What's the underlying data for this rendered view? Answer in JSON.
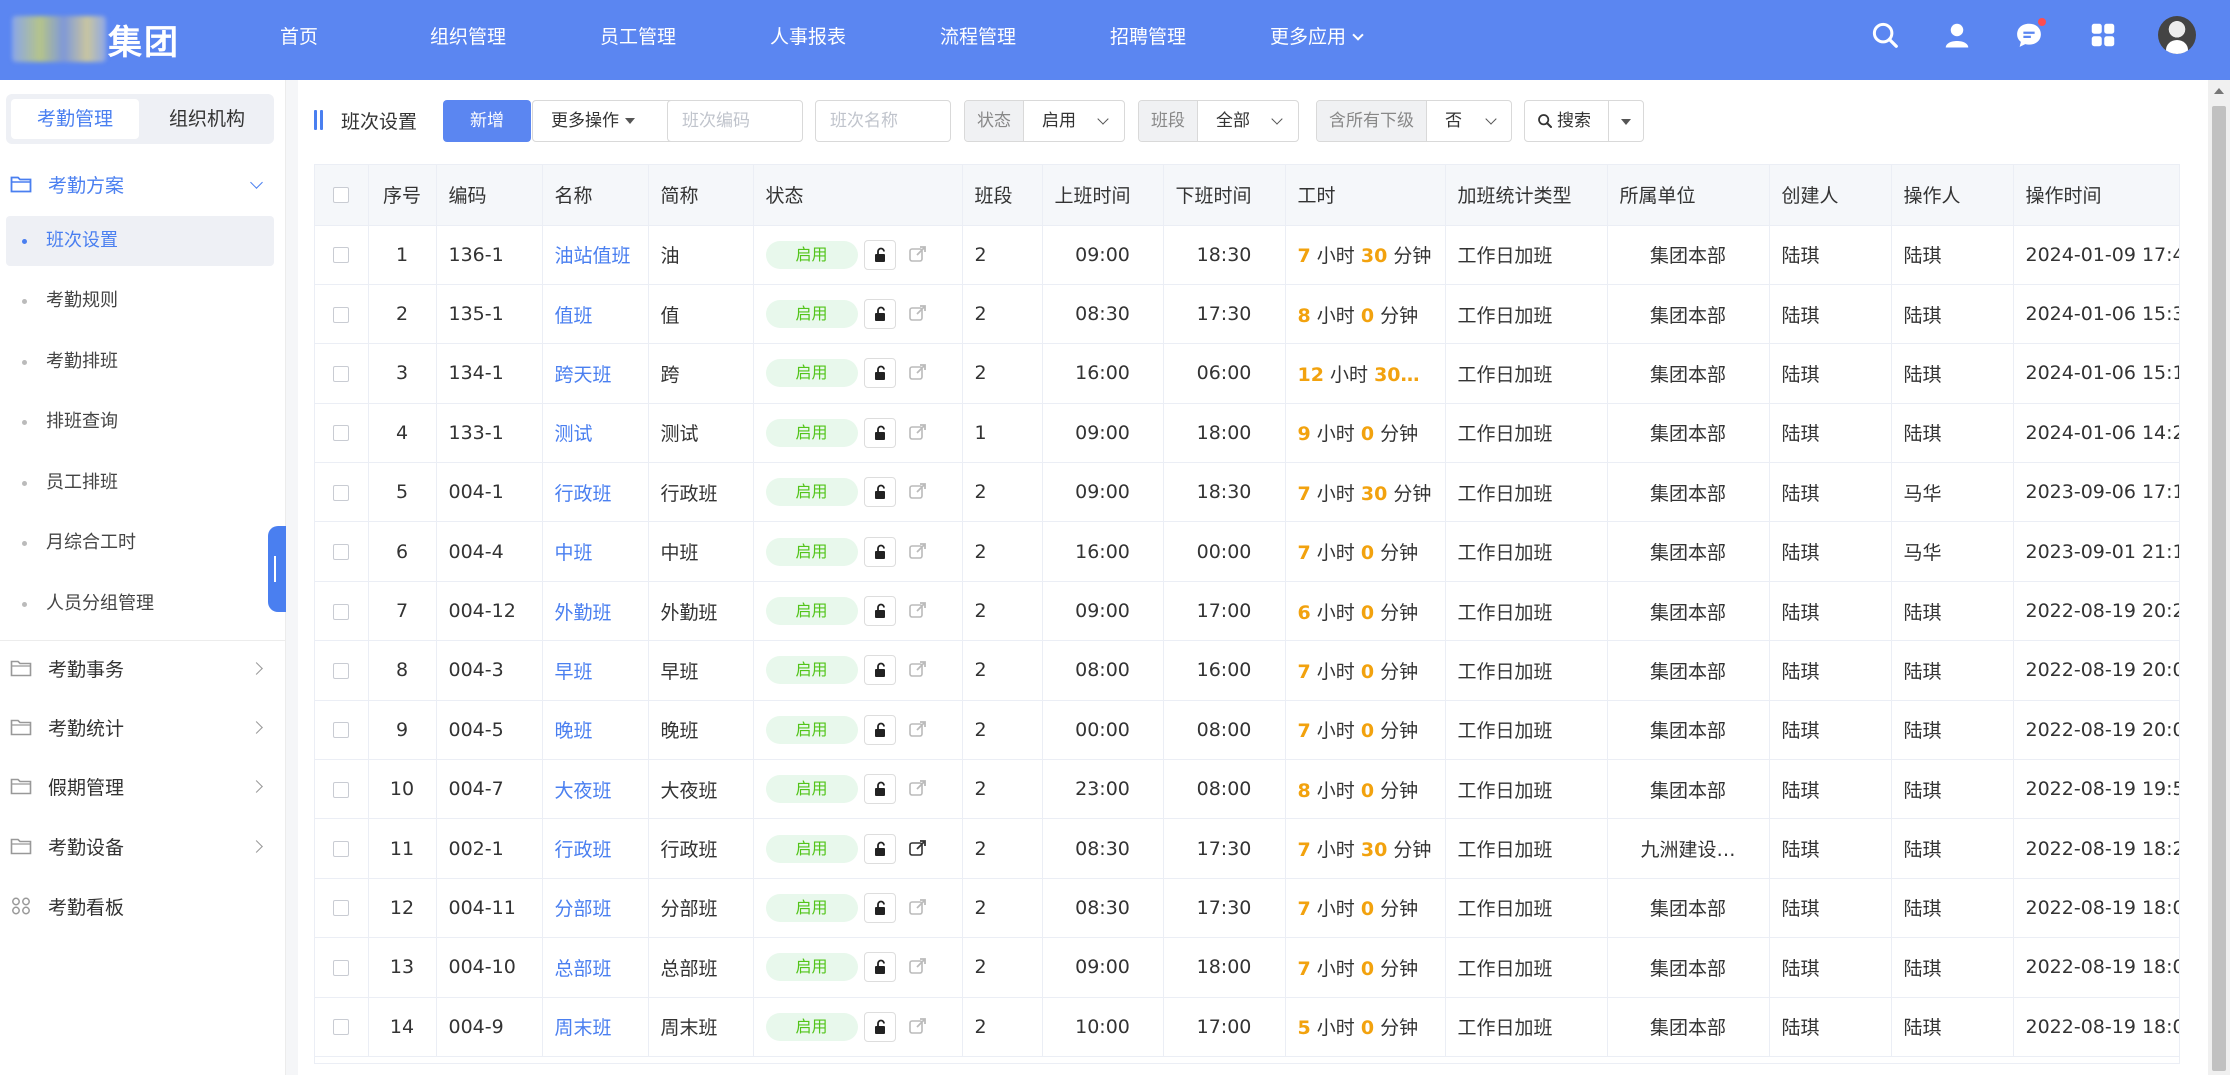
{
  "header": {
    "logo_text": "集团",
    "nav": [
      "首页",
      "组织管理",
      "员工管理",
      "人事报表",
      "流程管理",
      "招聘管理",
      "更多应用"
    ],
    "icons": [
      "search-icon",
      "user-icon",
      "chat-icon",
      "apps-grid-icon",
      "avatar"
    ],
    "accent_color": "#5b86f1"
  },
  "sidebar": {
    "tabs": [
      "考勤管理",
      "组织机构"
    ],
    "groups": [
      {
        "label": "考勤方案",
        "open": true
      },
      {
        "label": "考勤事务"
      },
      {
        "label": "考勤统计"
      },
      {
        "label": "假期管理"
      },
      {
        "label": "考勤设备"
      },
      {
        "label": "考勤看板"
      }
    ],
    "items": [
      "班次设置",
      "考勤规则",
      "考勤排班",
      "排班查询",
      "员工排班",
      "月综合工时",
      "人员分组管理"
    ]
  },
  "toolbar": {
    "title": "班次设置",
    "add_label": "新增",
    "more_label": "更多操作",
    "code_placeholder": "班次编码",
    "name_placeholder": "班次名称",
    "status_label": "状态",
    "status_value": "启用",
    "segment_label": "班段",
    "segment_value": "全部",
    "sub_label": "含所有下级",
    "sub_value": "否",
    "search_label": "搜索"
  },
  "table": {
    "columns": [
      "序号",
      "编码",
      "名称",
      "简称",
      "状态",
      "班段",
      "上班时间",
      "下班时间",
      "工时",
      "加班统计类型",
      "所属单位",
      "创建人",
      "操作人",
      "操作时间"
    ],
    "hour_unit": "小时",
    "minute_unit": "分钟",
    "rows": [
      {
        "idx": "1",
        "code": "136-1",
        "name": "油站值班",
        "short": "油",
        "status": "启用",
        "seg": "2",
        "on": "09:00",
        "off": "18:30",
        "h": "7",
        "m": "30",
        "ot": "工作日加班",
        "unit": "集团本部",
        "creator": "陆琪",
        "operator": "陆琪",
        "time": "2024-01-09 17:4"
      },
      {
        "idx": "2",
        "code": "135-1",
        "name": "值班",
        "short": "值",
        "status": "启用",
        "seg": "2",
        "on": "08:30",
        "off": "17:30",
        "h": "8",
        "m": "0",
        "ot": "工作日加班",
        "unit": "集团本部",
        "creator": "陆琪",
        "operator": "陆琪",
        "time": "2024-01-06 15:3"
      },
      {
        "idx": "3",
        "code": "134-1",
        "name": "跨天班",
        "short": "跨",
        "status": "启用",
        "seg": "2",
        "on": "16:00",
        "off": "06:00",
        "h": "12",
        "m": "30…",
        "ot": "工作日加班",
        "unit": "集团本部",
        "creator": "陆琪",
        "operator": "陆琪",
        "time": "2024-01-06 15:1",
        "truncated": true
      },
      {
        "idx": "4",
        "code": "133-1",
        "name": "测试",
        "short": "测试",
        "status": "启用",
        "seg": "1",
        "on": "09:00",
        "off": "18:00",
        "h": "9",
        "m": "0",
        "ot": "工作日加班",
        "unit": "集团本部",
        "creator": "陆琪",
        "operator": "陆琪",
        "time": "2024-01-06 14:2"
      },
      {
        "idx": "5",
        "code": "004-1",
        "name": "行政班",
        "short": "行政班",
        "status": "启用",
        "seg": "2",
        "on": "09:00",
        "off": "18:30",
        "h": "7",
        "m": "30",
        "ot": "工作日加班",
        "unit": "集团本部",
        "creator": "陆琪",
        "operator": "马华",
        "time": "2023-09-06 17:1"
      },
      {
        "idx": "6",
        "code": "004-4",
        "name": "中班",
        "short": "中班",
        "status": "启用",
        "seg": "2",
        "on": "16:00",
        "off": "00:00",
        "h": "7",
        "m": "0",
        "ot": "工作日加班",
        "unit": "集团本部",
        "creator": "陆琪",
        "operator": "马华",
        "time": "2023-09-01 21:1"
      },
      {
        "idx": "7",
        "code": "004-12",
        "name": "外勤班",
        "short": "外勤班",
        "status": "启用",
        "seg": "2",
        "on": "09:00",
        "off": "17:00",
        "h": "6",
        "m": "0",
        "ot": "工作日加班",
        "unit": "集团本部",
        "creator": "陆琪",
        "operator": "陆琪",
        "time": "2022-08-19 20:2"
      },
      {
        "idx": "8",
        "code": "004-3",
        "name": "早班",
        "short": "早班",
        "status": "启用",
        "seg": "2",
        "on": "08:00",
        "off": "16:00",
        "h": "7",
        "m": "0",
        "ot": "工作日加班",
        "unit": "集团本部",
        "creator": "陆琪",
        "operator": "陆琪",
        "time": "2022-08-19 20:0"
      },
      {
        "idx": "9",
        "code": "004-5",
        "name": "晚班",
        "short": "晚班",
        "status": "启用",
        "seg": "2",
        "on": "00:00",
        "off": "08:00",
        "h": "7",
        "m": "0",
        "ot": "工作日加班",
        "unit": "集团本部",
        "creator": "陆琪",
        "operator": "陆琪",
        "time": "2022-08-19 20:0"
      },
      {
        "idx": "10",
        "code": "004-7",
        "name": "大夜班",
        "short": "大夜班",
        "status": "启用",
        "seg": "2",
        "on": "23:00",
        "off": "08:00",
        "h": "8",
        "m": "0",
        "ot": "工作日加班",
        "unit": "集团本部",
        "creator": "陆琪",
        "operator": "陆琪",
        "time": "2022-08-19 19:5"
      },
      {
        "idx": "11",
        "code": "002-1",
        "name": "行政班",
        "short": "行政班",
        "status": "启用",
        "seg": "2",
        "on": "08:30",
        "off": "17:30",
        "h": "7",
        "m": "30",
        "ot": "工作日加班",
        "unit": "九洲建设…",
        "creator": "陆琪",
        "operator": "陆琪",
        "time": "2022-08-19 18:2",
        "share_active": true
      },
      {
        "idx": "12",
        "code": "004-11",
        "name": "分部班",
        "short": "分部班",
        "status": "启用",
        "seg": "2",
        "on": "08:30",
        "off": "17:30",
        "h": "7",
        "m": "0",
        "ot": "工作日加班",
        "unit": "集团本部",
        "creator": "陆琪",
        "operator": "陆琪",
        "time": "2022-08-19 18:0"
      },
      {
        "idx": "13",
        "code": "004-10",
        "name": "总部班",
        "short": "总部班",
        "status": "启用",
        "seg": "2",
        "on": "09:00",
        "off": "18:00",
        "h": "7",
        "m": "0",
        "ot": "工作日加班",
        "unit": "集团本部",
        "creator": "陆琪",
        "operator": "陆琪",
        "time": "2022-08-19 18:0"
      },
      {
        "idx": "14",
        "code": "004-9",
        "name": "周末班",
        "short": "周末班",
        "status": "启用",
        "seg": "2",
        "on": "10:00",
        "off": "17:00",
        "h": "5",
        "m": "0",
        "ot": "工作日加班",
        "unit": "集团本部",
        "creator": "陆琪",
        "operator": "陆琪",
        "time": "2022-08-19 18:0"
      }
    ]
  }
}
